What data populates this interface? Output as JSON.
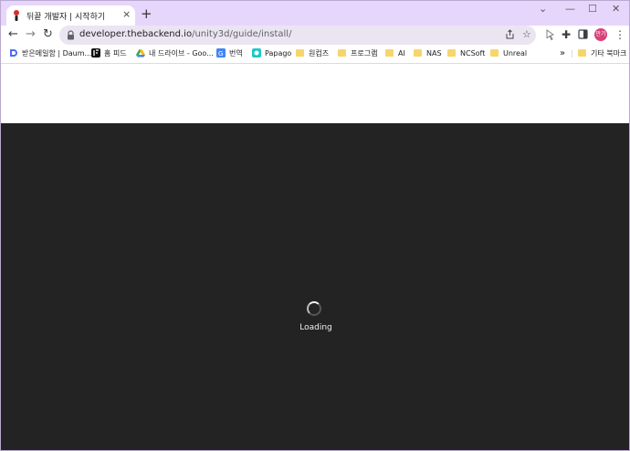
{
  "tab": {
    "title": "뒤끝 개발자 | 시작하기",
    "close": "×"
  },
  "newtab": "+",
  "window_controls": {
    "down": "⌄",
    "minimize": "—",
    "maximize": "☐",
    "close": "✕"
  },
  "nav": {
    "back": "←",
    "forward": "→",
    "reload": "↻"
  },
  "omnibox": {
    "host": "developer.thebackend.io",
    "path": "/unity3d/guide/install/"
  },
  "profile_label": "만기",
  "bookmarks": [
    {
      "label": "받은메일함 | Daum...",
      "icon": "daum-icon"
    },
    {
      "label": "홈 피드",
      "icon": "feed-icon"
    },
    {
      "label": "내 드라이브 - Goo...",
      "icon": "google-drive-icon"
    },
    {
      "label": "번역",
      "icon": "translate-icon"
    },
    {
      "label": "Papago",
      "icon": "papago-icon"
    },
    {
      "label": "원컴즈",
      "icon": "folder-icon"
    },
    {
      "label": "프로그램",
      "icon": "folder-icon"
    },
    {
      "label": "AI",
      "icon": "folder-icon"
    },
    {
      "label": "NAS",
      "icon": "folder-icon"
    },
    {
      "label": "NCSoft",
      "icon": "folder-icon"
    },
    {
      "label": "Unreal",
      "icon": "folder-icon"
    }
  ],
  "bookmarks_overflow": "»",
  "other_bookmarks": "기타 북마크",
  "loading_text": "Loading",
  "colors": {
    "tabstrip": "#e7d6fb",
    "page_dark": "#232323",
    "omnibox": "#ebe5f2",
    "folder": "#f6d66b"
  }
}
